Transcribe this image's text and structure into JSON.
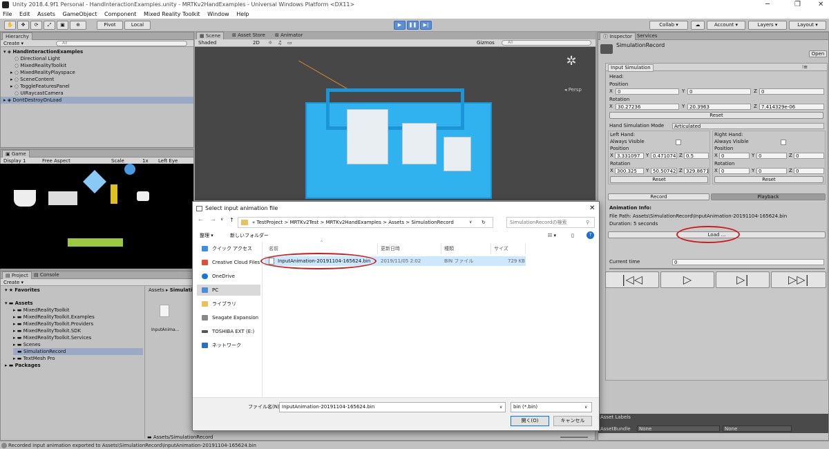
{
  "window": {
    "title": "Unity 2018.4.9f1 Personal - HandInteractionExamples.unity - MRTKv2HandExamples - Universal Windows Platform <DX11>"
  },
  "menu": [
    "File",
    "Edit",
    "Assets",
    "GameObject",
    "Component",
    "Mixed Reality Toolkit",
    "Window",
    "Help"
  ],
  "toolbar": {
    "pivot": "Pivot",
    "local": "Local",
    "collab": "Collab",
    "account": "Account",
    "layers": "Layers",
    "layout": "Layout"
  },
  "hierarchy": {
    "tab": "Hierarchy",
    "create": "Create",
    "search": "All",
    "scene": "HandInteractionExamples",
    "items": [
      "Directional Light",
      "MixedRealityToolkit",
      "MixedRealityPlayspace",
      "SceneContent",
      "ToggleFeaturesPanel",
      "UIRaycastCamera"
    ],
    "dont_destroy": "DontDestroyOnLoad"
  },
  "scene_view": {
    "tabs": [
      "Scene",
      "Asset Store",
      "Animator"
    ],
    "shading": "Shaded",
    "mode": "2D",
    "gizmos": "Gizmos",
    "search": "All",
    "persp": "Persp"
  },
  "game_view": {
    "tab": "Game",
    "display": "Display 1",
    "aspect": "Free Aspect",
    "scale": "Scale",
    "scale_val": "1x",
    "eye": "Left Eye"
  },
  "project": {
    "tabs": [
      "Project",
      "Console"
    ],
    "create": "Create",
    "favorites": "Favorites",
    "assets": "Assets",
    "folders": [
      "MixedRealityToolkit",
      "MixedRealityToolkit.Examples",
      "MixedRealityToolkit.Providers",
      "MixedRealityToolkit.SDK",
      "MixedRealityToolkit.Services",
      "Scenes",
      "SimulationRecord",
      "TextMesh Pro"
    ],
    "packages": "Packages",
    "breadcrumb_assets": "Assets",
    "breadcrumb_folder": "Simulati",
    "file_label": "InputAnima...",
    "path": "Assets/SimulationRecord"
  },
  "inspector": {
    "tabs": [
      "Inspector",
      "Services"
    ],
    "object": "SimulationRecord",
    "open": "Open",
    "component": "Input Simulation",
    "head": "Head:",
    "position": "Position",
    "rotation": "Rotation",
    "head_pos": {
      "x": "0",
      "y": "0",
      "z": "0"
    },
    "head_rot": {
      "x": "30.27236",
      "y": "20.3963",
      "z": "7.414329e-06"
    },
    "reset": "Reset",
    "hand_mode_label": "Hand Simulation Mode",
    "hand_mode": "Articulated",
    "left": "Left Hand:",
    "right": "Right Hand:",
    "always_visible": "Always Visible",
    "left_pos": {
      "x": "3.331097",
      "y": "0.471074",
      "z": "0.5"
    },
    "left_rot": {
      "x": "300.325",
      "y": "50.50742",
      "z": "329.8671"
    },
    "right_pos": {
      "x": "0",
      "y": "0",
      "z": "0"
    },
    "right_rot": {
      "x": "0",
      "y": "0",
      "z": "0"
    },
    "record": "Record",
    "playback": "Playback",
    "anim_info": "Animation Info:",
    "file_path": "File Path: Assets\\SimulationRecord\\InputAnimation-20191104-165624.bin",
    "duration": "Duration: 5 seconds",
    "load": "Load ...",
    "current_time": "Current time",
    "current_val": "0",
    "asset_labels": "Asset Labels",
    "asset_bundle": "AssetBundle",
    "none1": "None",
    "none2": "None"
  },
  "dialog": {
    "title": "Select input animation file",
    "address": [
      "TestProject",
      "MRTKv2Test",
      "MRTKv2HandExamples",
      "Assets",
      "SimulationRecord"
    ],
    "search": "SimulationRecordの検索",
    "organize": "整理",
    "new_folder": "新しいフォルダー",
    "nav": [
      "クイック アクセス",
      "Creative Cloud Files",
      "OneDrive",
      "PC",
      "ライブラリ",
      "Seagate Expansion Di",
      "TOSHIBA EXT (E:)",
      "ネットワーク"
    ],
    "columns": [
      "名前",
      "更新日時",
      "種類",
      "サイズ"
    ],
    "file": {
      "name": "InputAnimation-20191104-165624.bin",
      "date": "2019/11/05 2:02",
      "type": "BIN ファイル",
      "size": "729 KB"
    },
    "filename_label": "ファイル名(N):",
    "filename": "InputAnimation-20191104-165624.bin",
    "filter": "bin (*.bin)",
    "open": "開く(O)",
    "cancel": "キャンセル"
  },
  "status": "Recorded input animation exported to Assets\\SimulationRecord\\InputAnimation-20191104-165624.bin",
  "colors": {
    "highlight": "#cc1c1c",
    "selection": "#cce8ff",
    "play": "#5a8fd6"
  }
}
